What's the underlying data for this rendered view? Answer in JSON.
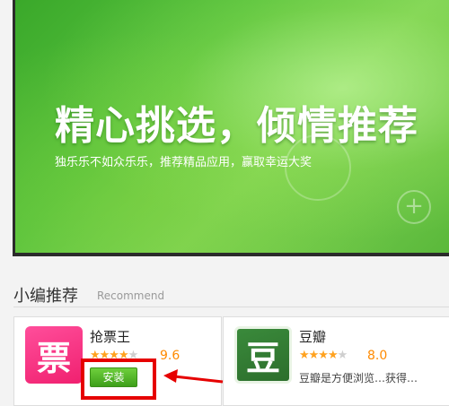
{
  "banner": {
    "title": "精心挑选，倾情推荐",
    "subtitle": "独乐乐不如众乐乐，推荐精品应用，赢取幸运大奖"
  },
  "section": {
    "title": "小编推荐",
    "subtitle": "Recommend"
  },
  "apps": [
    {
      "name": "抢票王",
      "icon_glyph": "票",
      "rating": 4.8,
      "score": "9.6",
      "install_label": "安装"
    },
    {
      "name": "豆瓣",
      "icon_glyph": "豆",
      "rating": 4.0,
      "score": "8.0",
      "description": "豆瓣是方便浏览…获得…"
    }
  ],
  "colors": {
    "highlight": "#e60000",
    "install": "#4aa824",
    "banner": "#57c23e"
  }
}
